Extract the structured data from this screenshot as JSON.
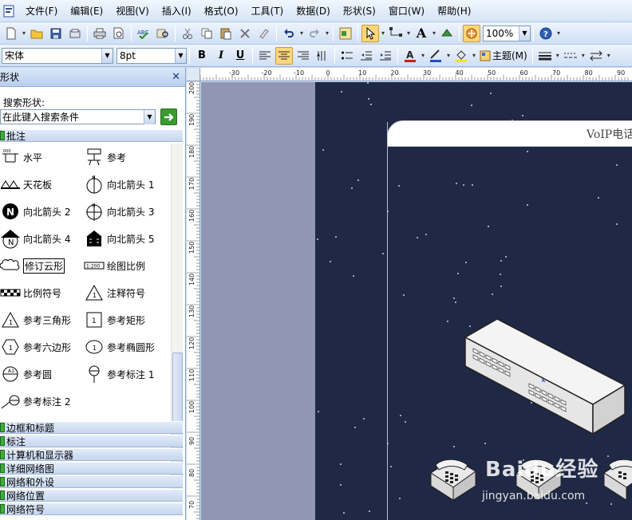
{
  "menubar": {
    "items": [
      "文件(F)",
      "编辑(E)",
      "视图(V)",
      "插入(I)",
      "格式(O)",
      "工具(T)",
      "数据(D)",
      "形状(S)",
      "窗口(W)",
      "帮助(H)"
    ]
  },
  "toolbar": {
    "zoom": "100%"
  },
  "format_toolbar": {
    "font": "宋体",
    "size": "8pt",
    "bold": "B",
    "italic": "I",
    "underline": "U",
    "theme": "主题(M)"
  },
  "shapes_panel": {
    "title": "形状",
    "search_label": "搜索形状:",
    "search_placeholder": "在此键入搜索条件",
    "active_stencil": "批注",
    "shapes": [
      "水平",
      "参考",
      "天花板",
      "向北箭头 1",
      "向北箭头 2",
      "向北箭头 3",
      "向北箭头 4",
      "向北箭头 5",
      "修订云形",
      "绘图比例",
      "比例符号",
      "注释符号",
      "参考三角形",
      "参考矩形",
      "参考六边形",
      "参考椭圆形",
      "参考圆",
      "参考标注 1",
      "参考标注 2"
    ],
    "stencils": [
      "边框和标题",
      "标注",
      "计算机和显示器",
      "详细网络图",
      "网络和外设",
      "网络位置",
      "网络符号"
    ]
  },
  "ruler": {
    "h_labels": [
      "-30",
      "-20",
      "-10",
      "0",
      "10",
      "20",
      "30",
      "40",
      "50",
      "60",
      "70",
      "80",
      "90"
    ],
    "v_labels": [
      "200",
      "190",
      "180",
      "170",
      "160",
      "150",
      "140",
      "130",
      "120",
      "110",
      "100",
      "90",
      "80",
      "70"
    ]
  },
  "drawing": {
    "title": "VoIP电话"
  },
  "watermark": {
    "brand": "Baidu经验",
    "url": "jingyan.baidu.com"
  },
  "colors": {
    "page_bg": "#1f2845",
    "accent": "#ffd77a"
  }
}
